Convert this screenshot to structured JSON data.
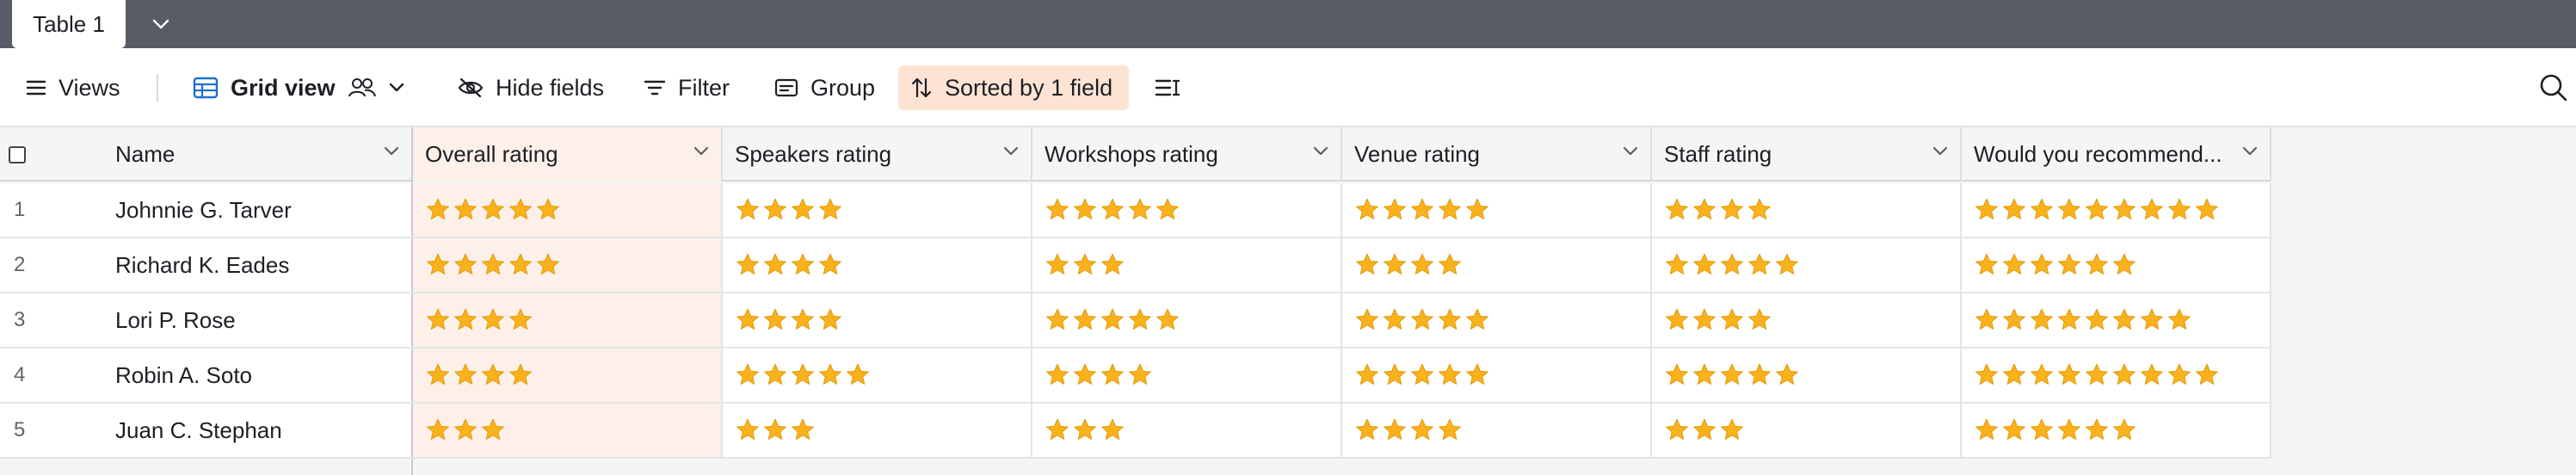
{
  "tabs": {
    "active_label": "Table 1"
  },
  "toolbar": {
    "views_label": "Views",
    "grid_view_label": "Grid view",
    "hide_fields_label": "Hide fields",
    "filter_label": "Filter",
    "group_label": "Group",
    "sorted_label": "Sorted by 1 field"
  },
  "colors": {
    "tabbar": "#575c66",
    "sorted_highlight": "#fde3d3",
    "sorted_column": "#fdf0e9",
    "star": "#f9b21b",
    "grid_view_icon": "#1f6fd0"
  },
  "columns": [
    {
      "key": "name",
      "label": "Name"
    },
    {
      "key": "overall",
      "label": "Overall rating"
    },
    {
      "key": "speakers",
      "label": "Speakers rating"
    },
    {
      "key": "workshops",
      "label": "Workshops rating"
    },
    {
      "key": "venue",
      "label": "Venue rating"
    },
    {
      "key": "staff",
      "label": "Staff rating"
    },
    {
      "key": "recommend",
      "label": "Would you recommend..."
    }
  ],
  "rows": [
    {
      "num": "1",
      "name": "Johnnie G. Tarver",
      "overall": 5,
      "speakers": 4,
      "workshops": 5,
      "venue": 5,
      "staff": 4,
      "recommend": 9
    },
    {
      "num": "2",
      "name": "Richard K. Eades",
      "overall": 5,
      "speakers": 4,
      "workshops": 3,
      "venue": 4,
      "staff": 5,
      "recommend": 6
    },
    {
      "num": "3",
      "name": "Lori P. Rose",
      "overall": 4,
      "speakers": 4,
      "workshops": 5,
      "venue": 5,
      "staff": 4,
      "recommend": 8
    },
    {
      "num": "4",
      "name": "Robin A. Soto",
      "overall": 4,
      "speakers": 5,
      "workshops": 4,
      "venue": 5,
      "staff": 5,
      "recommend": 9
    },
    {
      "num": "5",
      "name": "Juan C. Stephan",
      "overall": 3,
      "speakers": 3,
      "workshops": 3,
      "venue": 4,
      "staff": 3,
      "recommend": 6
    }
  ]
}
